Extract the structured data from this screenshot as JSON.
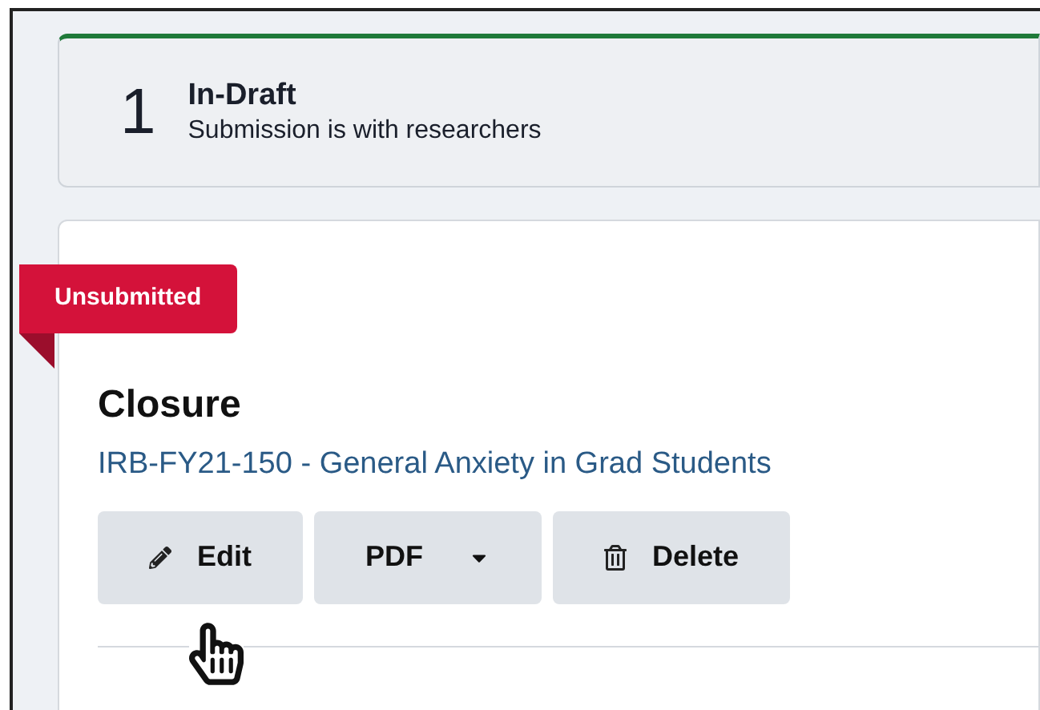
{
  "status": {
    "count": "1",
    "title": "In-Draft",
    "subtitle": "Submission is with researchers"
  },
  "submission": {
    "badge": "Unsubmitted",
    "title": "Closure",
    "link": "IRB-FY21-150 - General Anxiety in Grad Students",
    "buttons": [
      {
        "label": "Edit",
        "kind": "edit"
      },
      {
        "label": "PDF",
        "kind": "dropdown"
      },
      {
        "label": "Delete",
        "kind": "delete"
      }
    ]
  }
}
